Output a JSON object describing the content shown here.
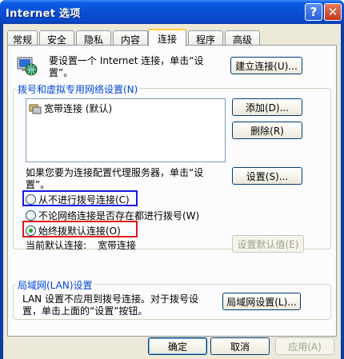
{
  "window": {
    "title": "Internet 选项",
    "help_symbol": "?",
    "close_symbol": "✕"
  },
  "tabs": [
    "常规",
    "安全",
    "隐私",
    "内容",
    "连接",
    "程序",
    "高级"
  ],
  "active_tab": "连接",
  "setup": {
    "text": "要设置一个 Internet 连接，单击“设",
    "text2": "置”。",
    "button": "建立连接(U)..."
  },
  "dialup_group": {
    "legend": "拨号和虚拟专用网络设置(N)",
    "list_items": [
      "宽带连接 (默认)"
    ],
    "add_button": "添加(D)...",
    "remove_button": "删除(R)",
    "settings_text_line1": "如果您要为连接配置代理服务器，单击“设",
    "settings_text_line2": "置”。",
    "settings_button": "设置(S)...",
    "options": [
      {
        "label": "从不进行拨号连接(C)",
        "checked": false
      },
      {
        "label": "不论网络连接是否存在都进行拨号(W)",
        "checked": false
      },
      {
        "label": "始终拨默认连接(O)",
        "checked": true
      }
    ],
    "current_default_label": "当前默认连接:",
    "current_default_value": "宽带连接",
    "set_default_button": "设置默认值(E)"
  },
  "lan_group": {
    "legend": "局域网(LAN)设置",
    "text_line1": "LAN 设置不应用到拨号连接。对于拨号设",
    "text_line2": "置，单击上面的“设置”按钮。",
    "button": "局域网设置(L)..."
  },
  "footer": {
    "ok": "确定",
    "cancel": "取消",
    "apply": "应用(A)"
  },
  "colors": {
    "title_blue": "#0a4fd6",
    "highlight_blue": "#1818e0",
    "highlight_red": "#e01818",
    "group_legend": "#0046d5"
  }
}
